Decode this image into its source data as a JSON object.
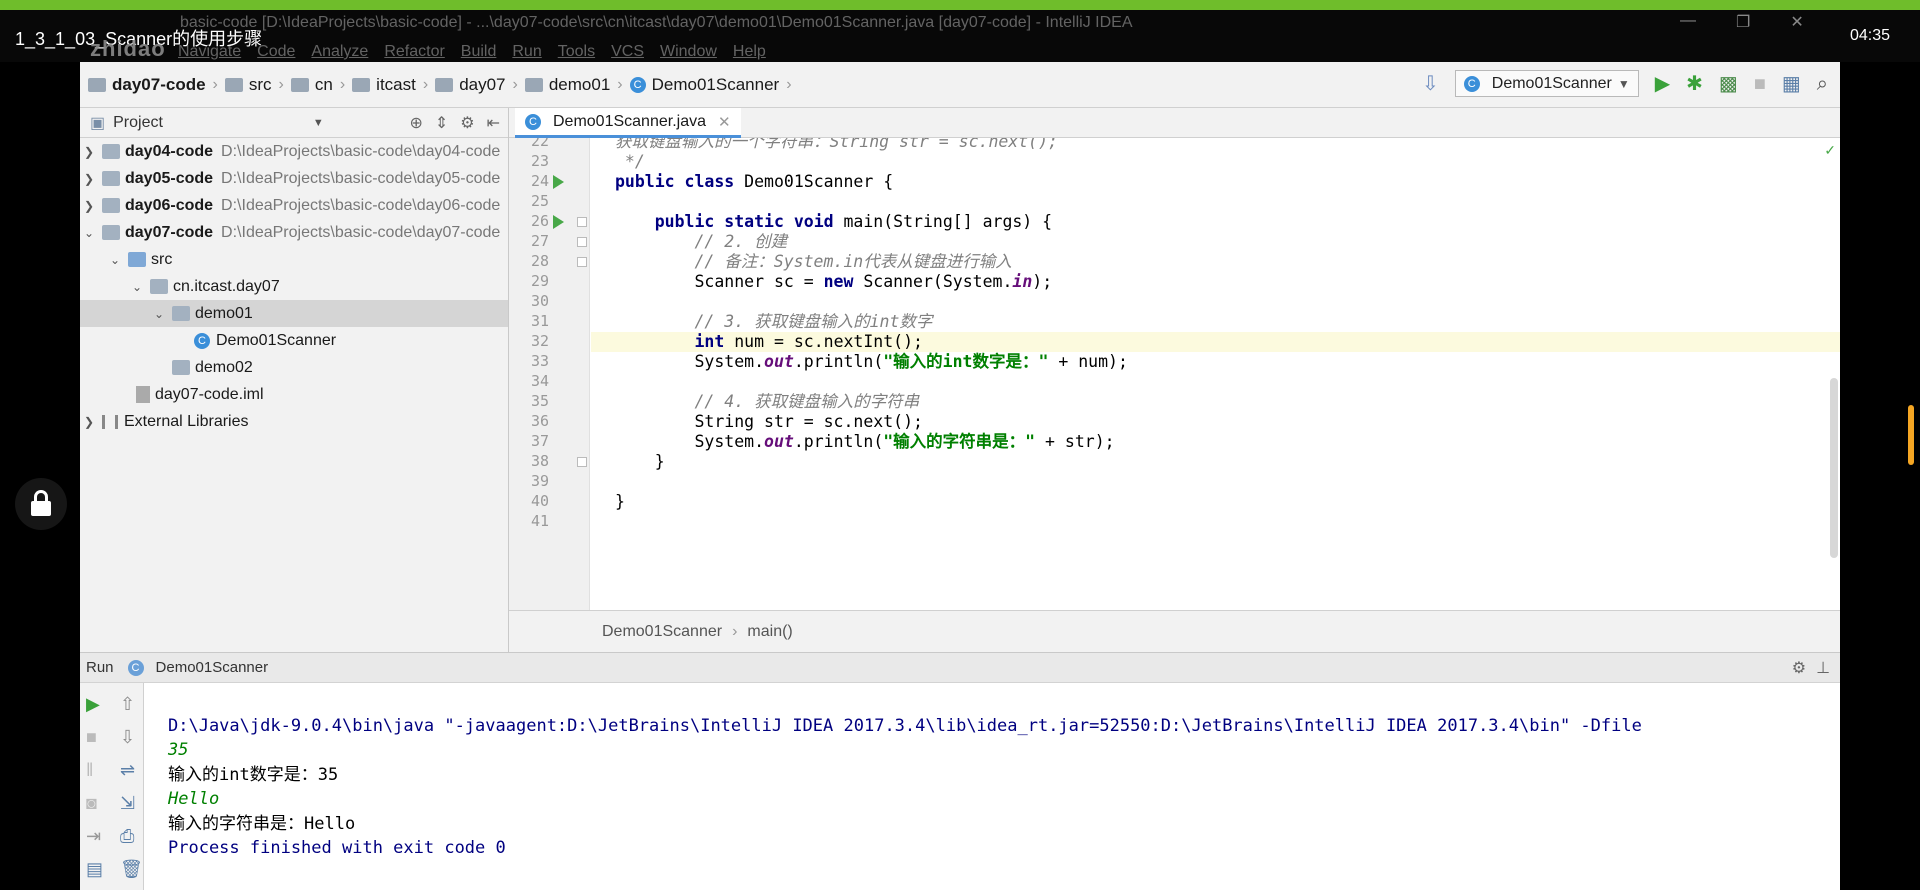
{
  "video": {
    "title": "1_3_1_03_Scanner的使用步骤",
    "time": "04:35"
  },
  "ide_window": {
    "title": "basic-code [D:\\IdeaProjects\\basic-code] - ...\\day07-code\\src\\cn\\itcast\\day07\\demo01\\Demo01Scanner.java [day07-code] - IntelliJ IDEA",
    "menu": [
      "Navigate",
      "Code",
      "Analyze",
      "Refactor",
      "Build",
      "Run",
      "Tools",
      "VCS",
      "Window",
      "Help"
    ],
    "watermark": "zhidao"
  },
  "navbar": {
    "crumbs": [
      "day07-code",
      "src",
      "cn",
      "itcast",
      "day07",
      "demo01",
      "Demo01Scanner"
    ],
    "run_config": "Demo01Scanner"
  },
  "project": {
    "title": "Project",
    "items": [
      {
        "name": "day04-code",
        "path": "D:\\IdeaProjects\\basic-code\\day04-code"
      },
      {
        "name": "day05-code",
        "path": "D:\\IdeaProjects\\basic-code\\day05-code"
      },
      {
        "name": "day06-code",
        "path": "D:\\IdeaProjects\\basic-code\\day06-code"
      },
      {
        "name": "day07-code",
        "path": "D:\\IdeaProjects\\basic-code\\day07-code"
      },
      {
        "name": "src"
      },
      {
        "name": "cn.itcast.day07"
      },
      {
        "name": "demo01"
      },
      {
        "name": "Demo01Scanner"
      },
      {
        "name": "demo02"
      },
      {
        "name": "day07-code.iml"
      },
      {
        "name": "External Libraries"
      }
    ]
  },
  "editor": {
    "tab": "Demo01Scanner.java",
    "breadcrumb": [
      "Demo01Scanner",
      "main()"
    ],
    "line_numbers": [
      "22",
      "23",
      "24",
      "25",
      "26",
      "27",
      "28",
      "29",
      "30",
      "31",
      "32",
      "33",
      "34",
      "35",
      "36",
      "37",
      "38",
      "39",
      "40",
      "41"
    ],
    "code": {
      "l22": "获取键盘输入的一个字符串：String str = sc.next();",
      "l23": " */",
      "l24_kw": "public class",
      "l24_rest": " Demo01Scanner {",
      "l26_kw": "public static void",
      "l26_rest": " main(String[] args) {",
      "l27": "// 2. 创建",
      "l28a": "// 备注：",
      "l28b": "System.in",
      "l28c": "代表从键盘进行输入",
      "l29a": "Scanner sc = ",
      "l29kw": "new",
      "l29b": " Scanner(System.",
      "l29fi": "in",
      "l29c": ");",
      "l31a": "// 3. 获取键盘输入的",
      "l31b": "int",
      "l31c": "数字",
      "l32kw": "int",
      "l32rest": " num = sc.nextInt();",
      "l33a": "System.",
      "l33fi": "out",
      "l33b": ".println(",
      "l33st": "\"输入的int数字是：\"",
      "l33c": " + num);",
      "l35": "// 4. 获取键盘输入的字符串",
      "l36": "String str = sc.next();",
      "l37a": "System.",
      "l37fi": "out",
      "l37b": ".println(",
      "l37st": "\"输入的字符串是：\"",
      "l37c": " + str);",
      "l38": "}",
      "l40": "}"
    }
  },
  "run": {
    "label": "Run",
    "config": "Demo01Scanner",
    "console": [
      "D:\\Java\\jdk-9.0.4\\bin\\java \"-javaagent:D:\\JetBrains\\IntelliJ IDEA 2017.3.4\\lib\\idea_rt.jar=52550:D:\\JetBrains\\IntelliJ IDEA 2017.3.4\\bin\" -Dfile",
      "35",
      "输入的int数字是：35",
      "Hello",
      "输入的字符串是：Hello",
      "",
      "Process finished with exit code 0"
    ]
  }
}
